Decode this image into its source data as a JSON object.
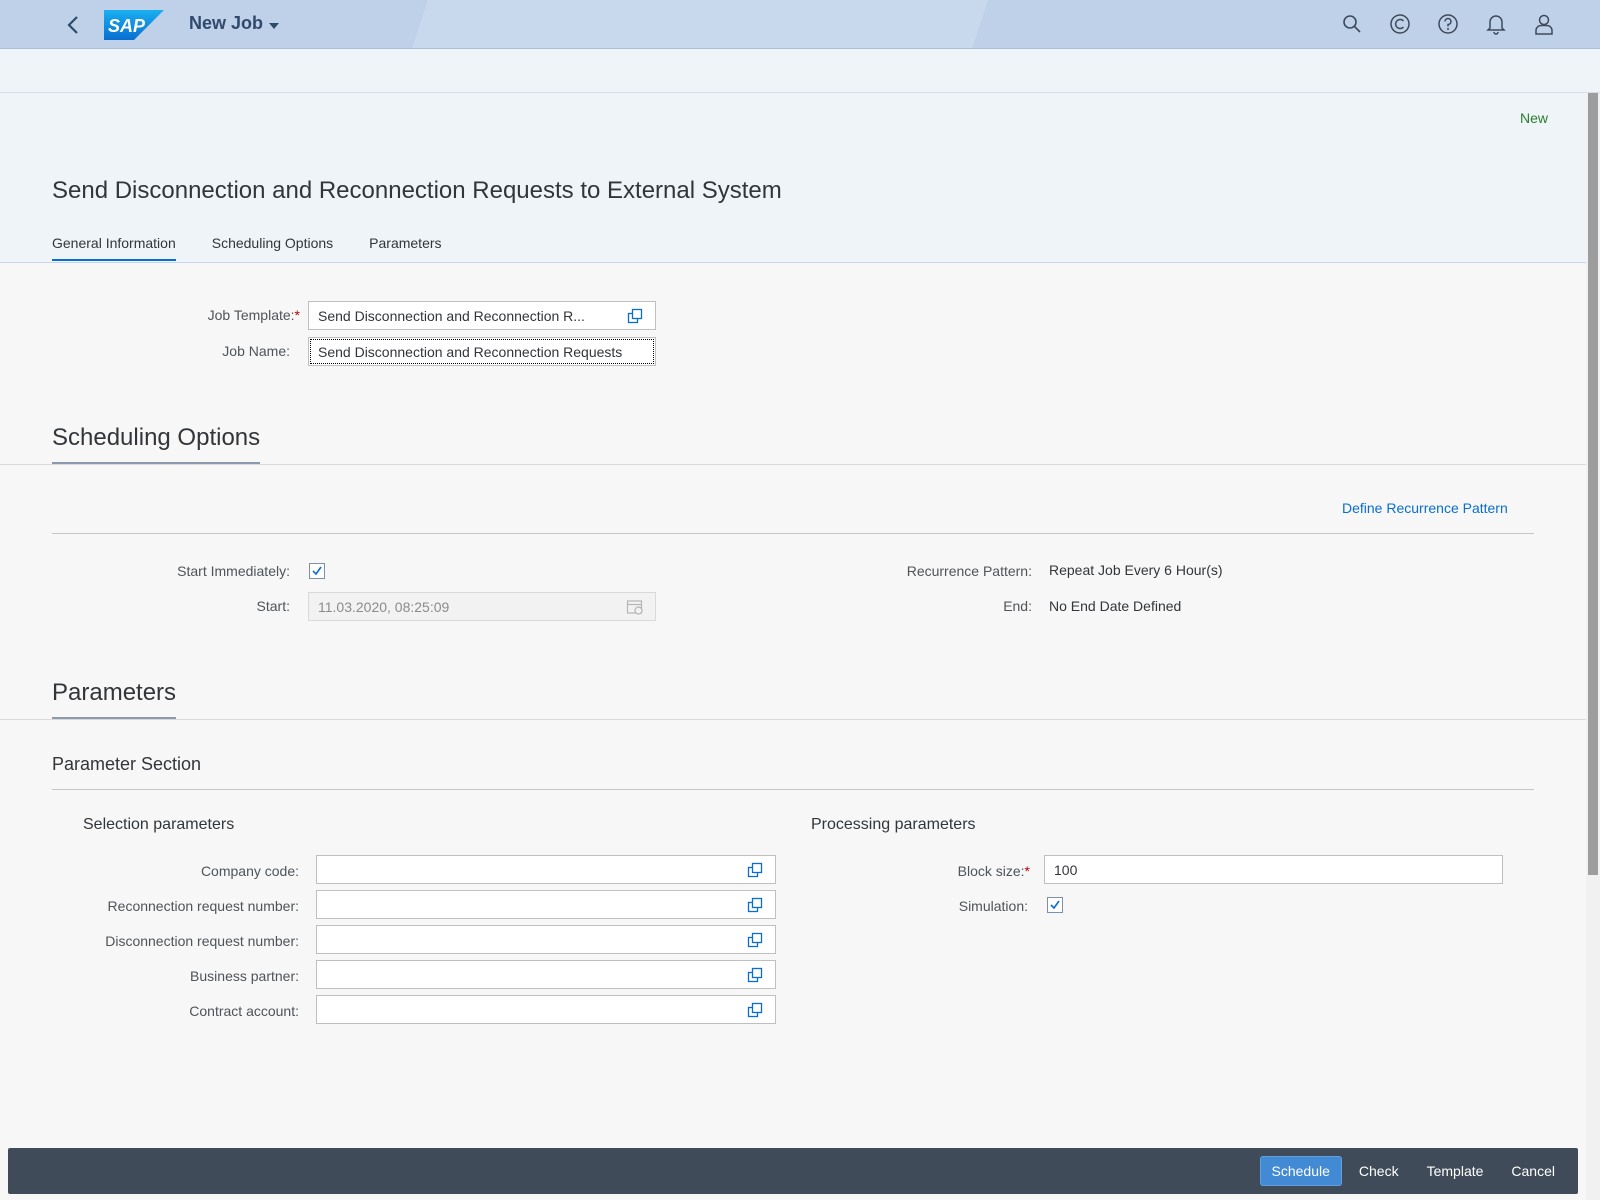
{
  "shell": {
    "app_title": "New Job",
    "logo_text": "SAP",
    "icons": [
      "search-icon",
      "copyright-icon",
      "help-icon",
      "notifications-icon",
      "user-icon"
    ]
  },
  "header": {
    "status": "New",
    "title": "Send Disconnection and Reconnection Requests to External System",
    "tabs": [
      {
        "label": "General Information",
        "active": true
      },
      {
        "label": "Scheduling Options",
        "active": false
      },
      {
        "label": "Parameters",
        "active": false
      }
    ]
  },
  "general": {
    "job_template_label": "Job Template:",
    "job_template_value": "Send Disconnection and Reconnection R...",
    "job_name_label": "Job Name:",
    "job_name_value": "Send Disconnection and Reconnection Requests"
  },
  "scheduling": {
    "section_title": "Scheduling Options",
    "define_link": "Define Recurrence Pattern",
    "start_immediately_label": "Start Immediately:",
    "start_immediately_checked": true,
    "start_label": "Start:",
    "start_value": "11.03.2020, 08:25:09",
    "recurrence_label": "Recurrence Pattern:",
    "recurrence_value": "Repeat Job Every 6 Hour(s)",
    "end_label": "End:",
    "end_value": "No End Date Defined"
  },
  "parameters": {
    "section_title": "Parameters",
    "subsection_title": "Parameter Section",
    "selection_title": "Selection parameters",
    "selection_fields": [
      {
        "label": "Company code:",
        "value": ""
      },
      {
        "label": "Reconnection request number:",
        "value": ""
      },
      {
        "label": "Disconnection request number:",
        "value": ""
      },
      {
        "label": "Business partner:",
        "value": ""
      },
      {
        "label": "Contract account:",
        "value": ""
      }
    ],
    "processing_title": "Processing parameters",
    "block_size_label": "Block size:",
    "block_size_value": "100",
    "simulation_label": "Simulation:",
    "simulation_checked": true
  },
  "footer": {
    "schedule": "Schedule",
    "check": "Check",
    "template": "Template",
    "cancel": "Cancel"
  },
  "colors": {
    "shell_bg": "#bfd1e8",
    "accent": "#0a6ed1",
    "status_green": "#2b7d2b",
    "footer_bg": "#3f4b59",
    "required": "#bb0000"
  }
}
